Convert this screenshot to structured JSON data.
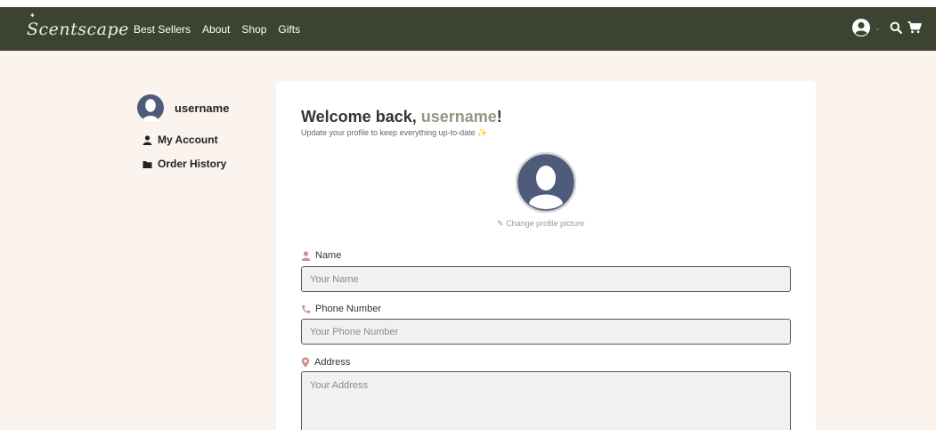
{
  "nav": {
    "brand": "Scentscape",
    "links": [
      "Best Sellers",
      "About",
      "Shop",
      "Gifts"
    ],
    "icons": [
      "user-circle-icon",
      "chevron-down-icon",
      "search-icon",
      "cart-icon"
    ]
  },
  "sidebar": {
    "username": "username",
    "items": [
      {
        "label": "My Account",
        "icon": "user-icon"
      },
      {
        "label": "Order History",
        "icon": "folder-icon"
      }
    ]
  },
  "profile": {
    "welcome_prefix": "Welcome back, ",
    "username": "username",
    "welcome_suffix": "!",
    "subtitle": "Update your profile to keep everything up-to-date",
    "sparkle": "✨",
    "change_picture": "Change profile picture"
  },
  "form": {
    "name_label": "Name",
    "name_placeholder": "Your Name",
    "phone_label": "Phone Number",
    "phone_placeholder": "Your Phone Number",
    "address_label": "Address",
    "address_placeholder": "Your Address"
  },
  "colors": {
    "navbar": "#3c4331",
    "page_bg": "#fbf3ee",
    "accent_username": "#8e9a86",
    "label_icon": "#c9928e",
    "avatar": "#4f5b7b"
  }
}
